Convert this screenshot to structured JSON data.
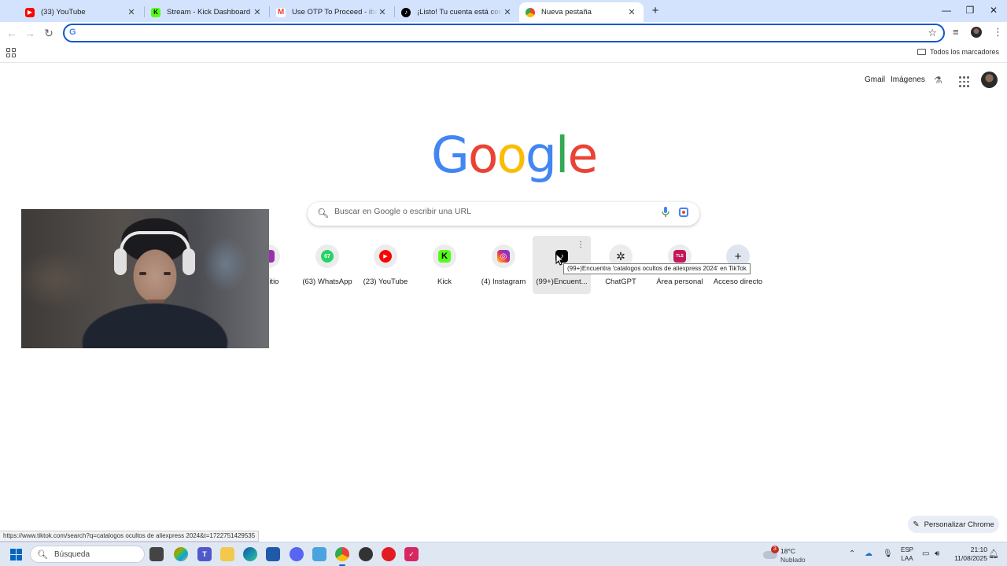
{
  "tabs": [
    {
      "title": "(33) YouTube",
      "favicon": "youtube-icon",
      "color": "#ff0000"
    },
    {
      "title": "Stream - Kick Dashboard",
      "favicon": "kick-icon",
      "color": "#53fc18"
    },
    {
      "title": "Use OTP To Proceed - ibareldio",
      "favicon": "gmail-icon",
      "color": "#ea4335"
    },
    {
      "title": "¡Listo! Tu cuenta está conectada",
      "favicon": "tiktok-icon",
      "color": "#000000"
    },
    {
      "title": "Nueva pestaña",
      "favicon": "chrome-icon",
      "color": "#4285f4",
      "active": true
    }
  ],
  "toolbar": {
    "omnibox_value": ""
  },
  "bookmarks": {
    "all_bookmarks_label": "Todos los marcadores"
  },
  "header": {
    "gmail": "Gmail",
    "images": "Imágenes"
  },
  "search": {
    "placeholder": "Buscar en Google o escribir una URL"
  },
  "shortcuts": [
    {
      "label": "al sitio",
      "color": "#9b2fae"
    },
    {
      "label": "(63) WhatsApp",
      "color": "#25d366",
      "glyph": "67"
    },
    {
      "label": "(23) YouTube",
      "color": "#ff0000",
      "glyph": "▶"
    },
    {
      "label": "Kick",
      "color": "#53fc18",
      "glyph": "K"
    },
    {
      "label": "(4) Instagram",
      "color": "#d62976",
      "glyph": "◎"
    },
    {
      "label": "(99+)Encuent...",
      "color": "#000000",
      "glyph": "♪"
    },
    {
      "label": "ChatGPT",
      "color": "#202123",
      "glyph": "✲"
    },
    {
      "label": "Área personal",
      "color": "#c2185b",
      "glyph": "TLS"
    },
    {
      "label": "Acceso directo",
      "color": "#1f1f1f",
      "glyph": "+"
    }
  ],
  "tooltip": "(99+)Encuentra 'catalogos ocultos de aliexpress 2024' en TikTok",
  "customize_label": "Personalizar Chrome",
  "status_url": "https://www.tiktok.com/search?q=catalogos ocultos de aliexpress 2024&t=1722751429535",
  "taskbar": {
    "search_label": "Búsqueda",
    "weather_temp": "18°C",
    "weather_desc": "Nublado",
    "weather_badge": "3",
    "lang_1": "ESP",
    "lang_2": "LAA",
    "time": "21:10",
    "date": "11/08/2025"
  }
}
